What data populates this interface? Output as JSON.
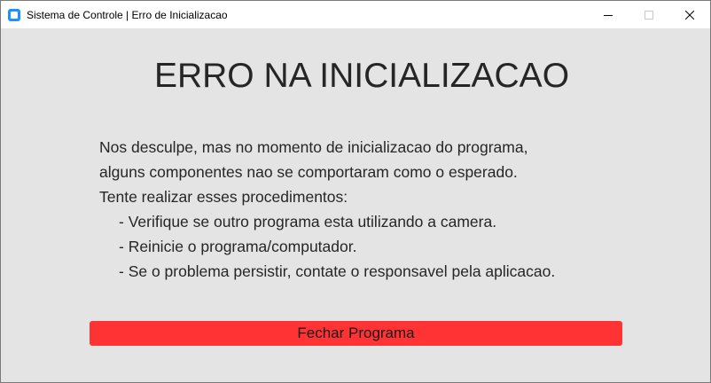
{
  "window": {
    "title": "Sistema de Controle | Erro de Inicializacao",
    "icons": {
      "app": "app-icon",
      "minimize": "minimize-icon",
      "maximize": "maximize-icon",
      "close": "close-icon"
    }
  },
  "main": {
    "heading": "ERRO NA INICIALIZACAO",
    "message_lines": [
      "Nos desculpe, mas no momento de inicializacao do programa,",
      "alguns componentes nao se comportaram como o esperado.",
      "Tente realizar esses procedimentos:"
    ],
    "steps": [
      "- Verifique se outro programa esta utilizando a camera.",
      "- Reinicie o programa/computador.",
      "- Se o problema persistir, contate o responsavel pela aplicacao."
    ],
    "close_button_label": "Fechar Programa"
  },
  "colors": {
    "background": "#e4e4e4",
    "titlebar": "#ffffff",
    "button": "#ff3333",
    "text": "#262626",
    "app_icon": "#1e90ff"
  }
}
